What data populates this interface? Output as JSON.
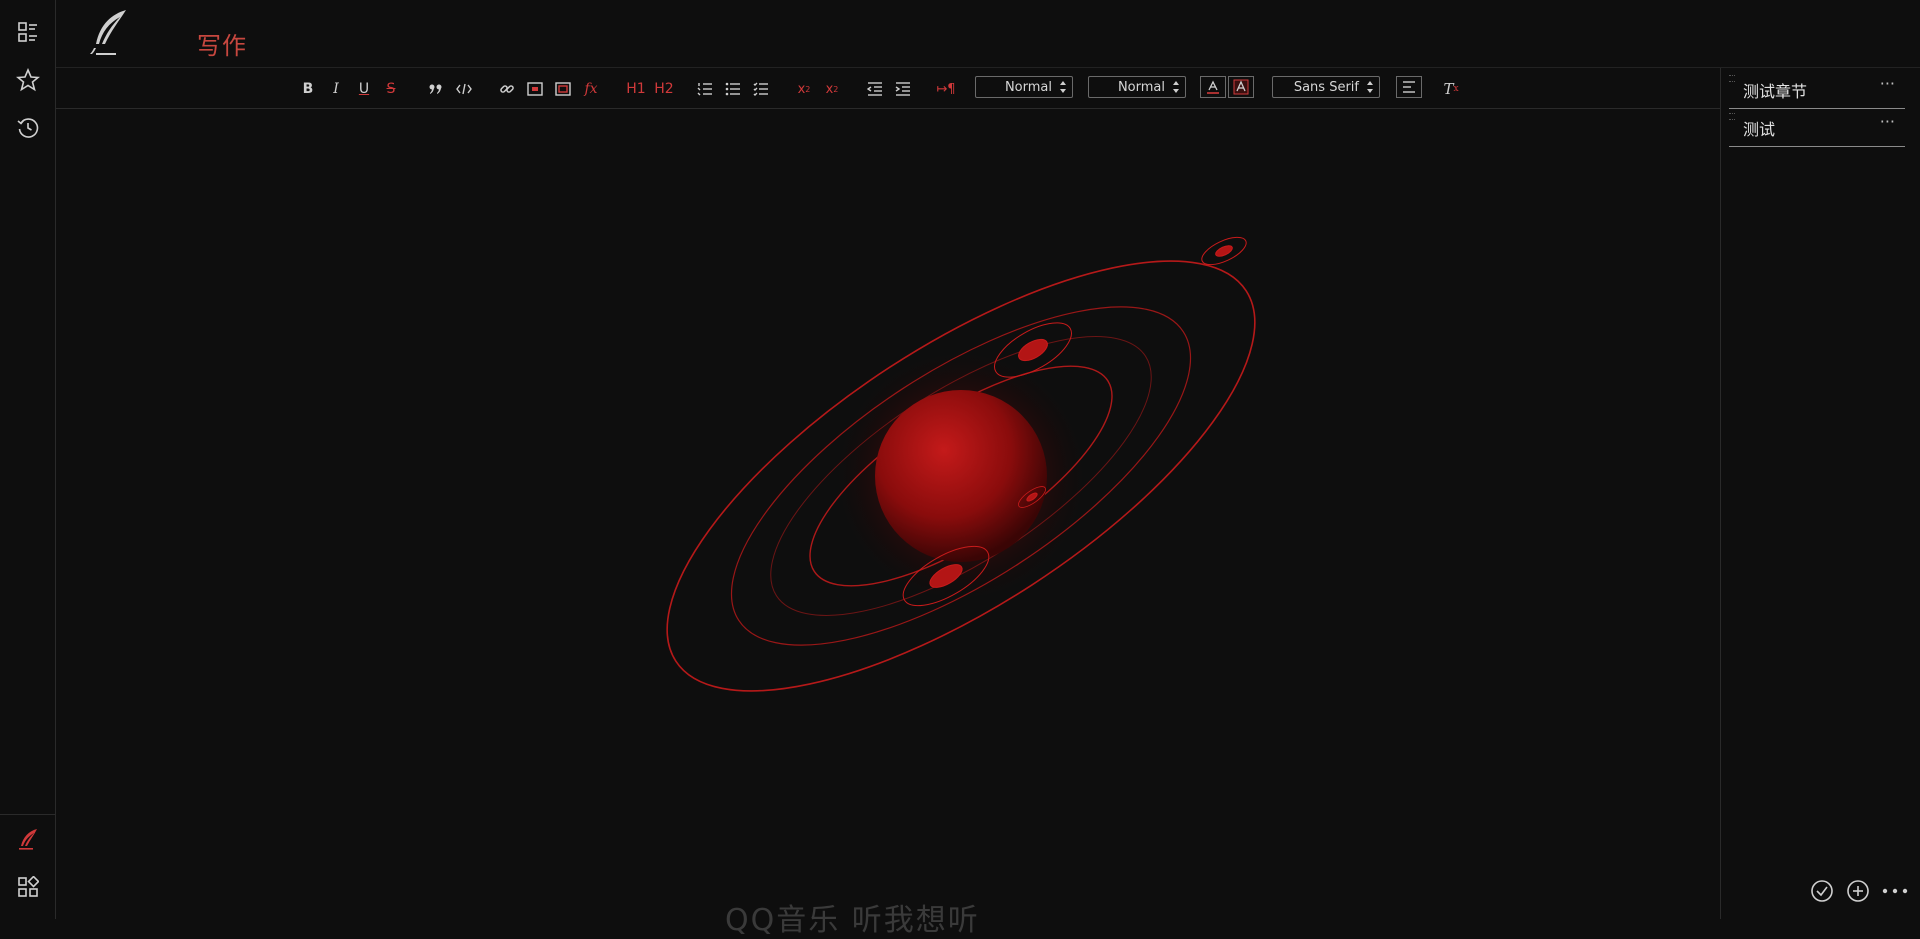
{
  "app": {
    "title": "写作"
  },
  "rail": {
    "top_icons": [
      "outline-list-icon",
      "star-icon",
      "history-clock-icon"
    ],
    "bottom_icons": [
      "quill-pen-icon",
      "apps-grid-icon"
    ]
  },
  "toolbar": {
    "header_select": "Normal",
    "size_select": "Normal",
    "font_select": "Sans Serif",
    "bold_label": "B",
    "italic_label": "I",
    "underline_label": "U",
    "strike_label": "S",
    "h1_label": "H1",
    "h2_label": "H2",
    "formula_label": "fx"
  },
  "sidebar": {
    "chapters": [
      {
        "label": "测试章节",
        "more": "···"
      },
      {
        "label": "测试",
        "more": "···"
      }
    ]
  },
  "footer": {
    "text": "QQ音乐 听我想听"
  },
  "colors": {
    "accent": "#d0393a",
    "background": "#0e0e0e",
    "text": "#d8d8d8"
  }
}
